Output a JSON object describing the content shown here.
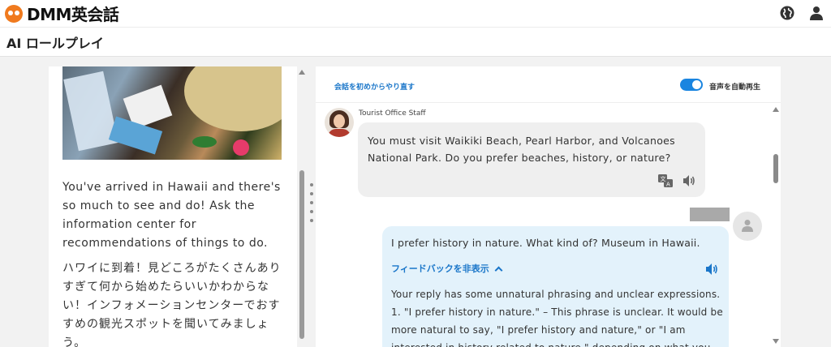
{
  "header": {
    "logo_text": "DMM英会話",
    "globe_icon": "globe-icon",
    "user_icon": "user-icon"
  },
  "titlebar": {
    "title": "AI ロールプレイ"
  },
  "scenario": {
    "description_en": "You've arrived in Hawaii and there's so much to see and do! Ask the information center for recommendations of things to do.",
    "description_ja": "ハワイに到着！見どころがたくさんありすぎて何から始めたらいいかわからない！インフォメーションセンターでおすすめの観光スポットを聞いてみましょう。"
  },
  "chat": {
    "restart_label": "会話を初めからやり直す",
    "autoplay_label": "音声を自動再生",
    "autoplay_on": true,
    "messages": [
      {
        "speaker": "Tourist Office Staff",
        "text": "You must visit Waikiki Beach, Pearl Harbor, and Volcanoes National Park. Do you prefer beaches, history, or nature?"
      },
      {
        "speaker": "user",
        "text": "I prefer history in nature. What kind of? Museum in Hawaii.",
        "feedback_toggle_label": "フィードバックを非表示",
        "feedback": "Your reply has some unnatural phrasing and unclear expressions. 1. \"I prefer history in nature.\" – This phrase is unclear. It would be more natural to say, \"I prefer history and nature,\" or \"I am interested in history related to nature,\" depending on what you"
      }
    ]
  },
  "colors": {
    "accent": "#1a76c9",
    "toggle": "#1a85e0",
    "user_bubble": "#e3f2fb",
    "bot_bubble": "#efefef",
    "logo_orange": "#f07a1e"
  }
}
